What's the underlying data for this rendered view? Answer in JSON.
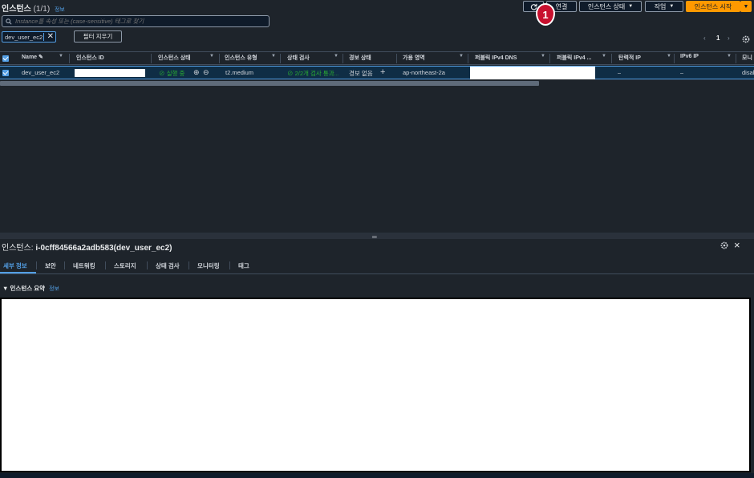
{
  "header": {
    "title": "인스턴스",
    "count": "(1/1)",
    "info": "정보"
  },
  "toolbar": {
    "connect_label": "연결",
    "state_label": "인스턴스 상태",
    "actions_label": "작업",
    "launch_label": "인스턴스 시작",
    "annotation_number": "1"
  },
  "search": {
    "placeholder": "Instance를 속성 또는 (case-sensitive) 태그로 찾기"
  },
  "filter": {
    "token": "dev_user_ec2",
    "clear_label": "필터 지우기"
  },
  "pagination": {
    "prev": "‹",
    "page": "1",
    "next": "›"
  },
  "table": {
    "columns": [
      "Name",
      "인스턴스 ID",
      "인스턴스 상태",
      "인스턴스 유형",
      "상태 검사",
      "경보 상태",
      "가용 영역",
      "퍼블릭 IPv4 DNS",
      "퍼블릭 IPv4 ...",
      "탄력적 IP",
      "IPv6 IP",
      "모니"
    ],
    "row": {
      "name": "dev_user_ec2",
      "state": "실행 중",
      "type": "t2.medium",
      "status_check": "2/2개 검사 통과...",
      "alarm": "경보 없음",
      "alarm_add": "+",
      "az": "ap-northeast-2a",
      "elastic_ip": "–",
      "ipv6": "–",
      "monitoring": "disal"
    }
  },
  "detail": {
    "title_prefix": "인스턴스:",
    "instance_id": "i-0cff84566a2adb583(dev_user_ec2)",
    "tabs": [
      "세부 정보",
      "보안",
      "네트워킹",
      "스토리지",
      "상태 검사",
      "모니터링",
      "태그"
    ],
    "summary_title": "인스턴스 요약",
    "summary_info": "정보"
  },
  "colors": {
    "accent": "#539fe5",
    "launch": "#ff9900",
    "badge": "#c8102e",
    "running": "#29ad32"
  }
}
